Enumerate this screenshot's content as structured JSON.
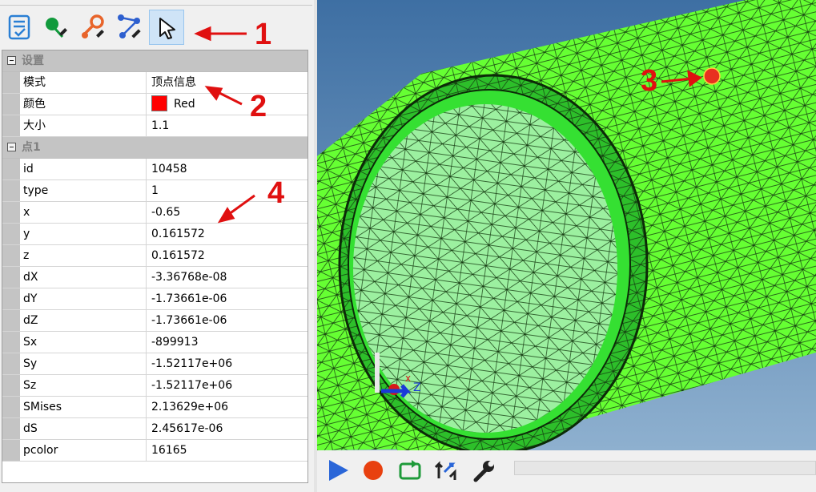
{
  "toolbar": {
    "buttons": [
      {
        "name": "view-list-icon",
        "active": false
      },
      {
        "name": "add-point-icon",
        "active": false
      },
      {
        "name": "edit-point-icon",
        "active": false
      },
      {
        "name": "edit-node-icon",
        "active": false
      },
      {
        "name": "select-cursor-icon",
        "active": true
      }
    ]
  },
  "properties": {
    "groups": [
      {
        "title": "设置",
        "rows": [
          {
            "name": "模式",
            "value": "顶点信息"
          },
          {
            "name": "颜色",
            "value": "Red",
            "swatch": "#ff0000"
          },
          {
            "name": "大小",
            "value": "1.1"
          }
        ]
      },
      {
        "title": "点1",
        "rows": [
          {
            "name": "id",
            "value": "10458"
          },
          {
            "name": "type",
            "value": "1"
          },
          {
            "name": "x",
            "value": "-0.65"
          },
          {
            "name": "y",
            "value": "0.161572"
          },
          {
            "name": "z",
            "value": "0.161572"
          },
          {
            "name": "dX",
            "value": "-3.36768e-08"
          },
          {
            "name": "dY",
            "value": "-1.73661e-06"
          },
          {
            "name": "dZ",
            "value": "-1.73661e-06"
          },
          {
            "name": "Sx",
            "value": "-899913"
          },
          {
            "name": "Sy",
            "value": "-1.52117e+06"
          },
          {
            "name": "Sz",
            "value": "-1.52117e+06"
          },
          {
            "name": "SMises",
            "value": "2.13629e+06"
          },
          {
            "name": "dS",
            "value": "2.45617e-06"
          },
          {
            "name": "pcolor",
            "value": "16165"
          }
        ]
      }
    ]
  },
  "viewport": {
    "mesh_color": "#66ff33",
    "axis_labels": {
      "x": "x",
      "z": "Z"
    }
  },
  "playback": {
    "buttons": [
      "play-icon",
      "record-icon",
      "loop-icon",
      "swap-icon",
      "wrench-icon"
    ]
  },
  "annotations": [
    {
      "label": "1"
    },
    {
      "label": "2"
    },
    {
      "label": "3"
    },
    {
      "label": "4"
    }
  ],
  "colors": {
    "annotation": "#e01010",
    "selected_point": "#e83020"
  }
}
